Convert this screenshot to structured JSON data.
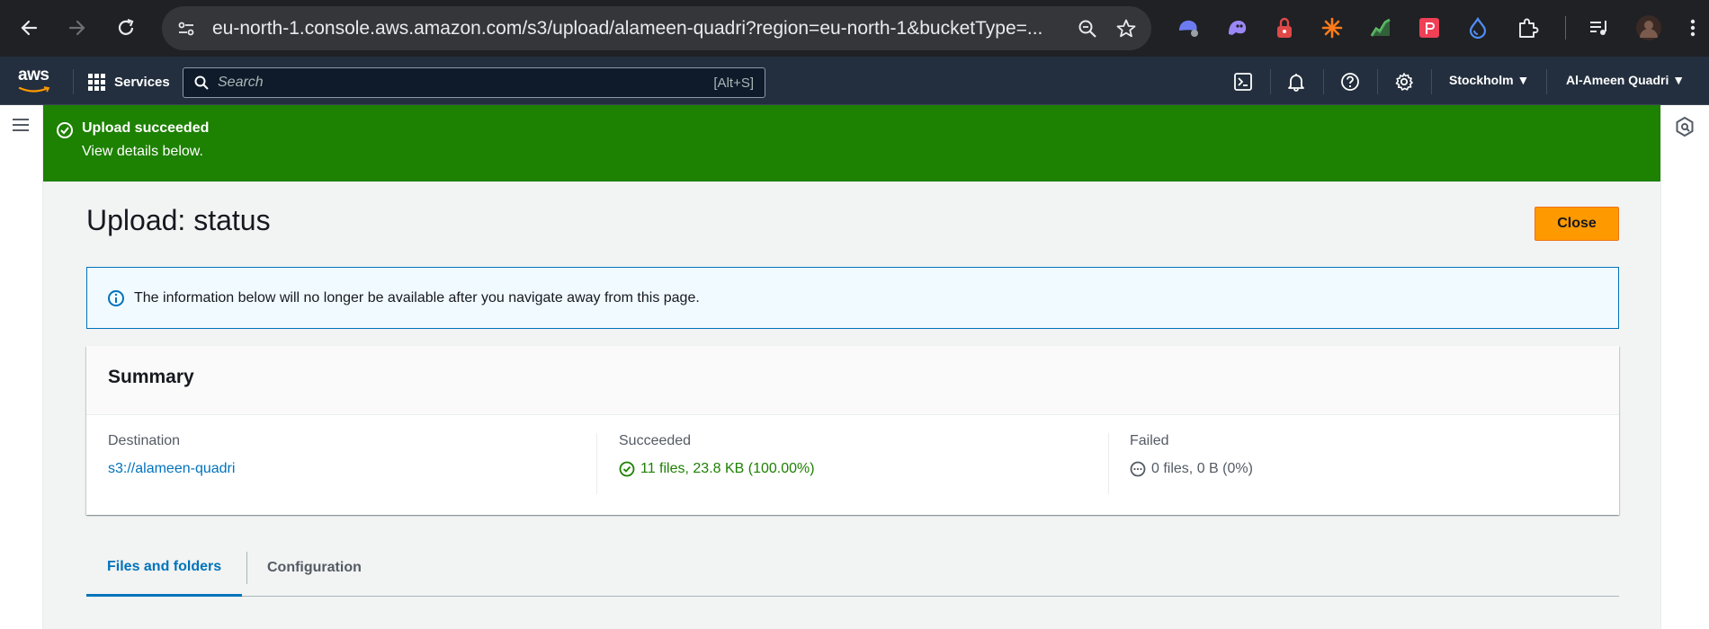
{
  "browser": {
    "url": "eu-north-1.console.aws.amazon.com/s3/upload/alameen-quadri?region=eu-north-1&bucketType=..."
  },
  "aws_header": {
    "logo": "aws",
    "services_label": "Services",
    "search_placeholder": "Search",
    "search_shortcut": "[Alt+S]",
    "region": "Stockholm",
    "account": "Al-Ameen Quadri"
  },
  "flash": {
    "title": "Upload succeeded",
    "message": "View details below."
  },
  "page": {
    "title": "Upload: status",
    "close_label": "Close",
    "info_text": "The information below will no longer be available after you navigate away from this page."
  },
  "summary": {
    "title": "Summary",
    "destination_label": "Destination",
    "destination_value": "s3://alameen-quadri",
    "succeeded_label": "Succeeded",
    "succeeded_value": "11 files, 23.8 KB (100.00%)",
    "failed_label": "Failed",
    "failed_value": "0 files, 0 B (0%)"
  },
  "tabs": [
    {
      "label": "Files and folders",
      "active": true
    },
    {
      "label": "Configuration",
      "active": false
    }
  ],
  "colors": {
    "success_green": "#1d8102",
    "aws_orange": "#ff9900",
    "link_blue": "#0073bb",
    "aws_navy": "#232f3e"
  }
}
